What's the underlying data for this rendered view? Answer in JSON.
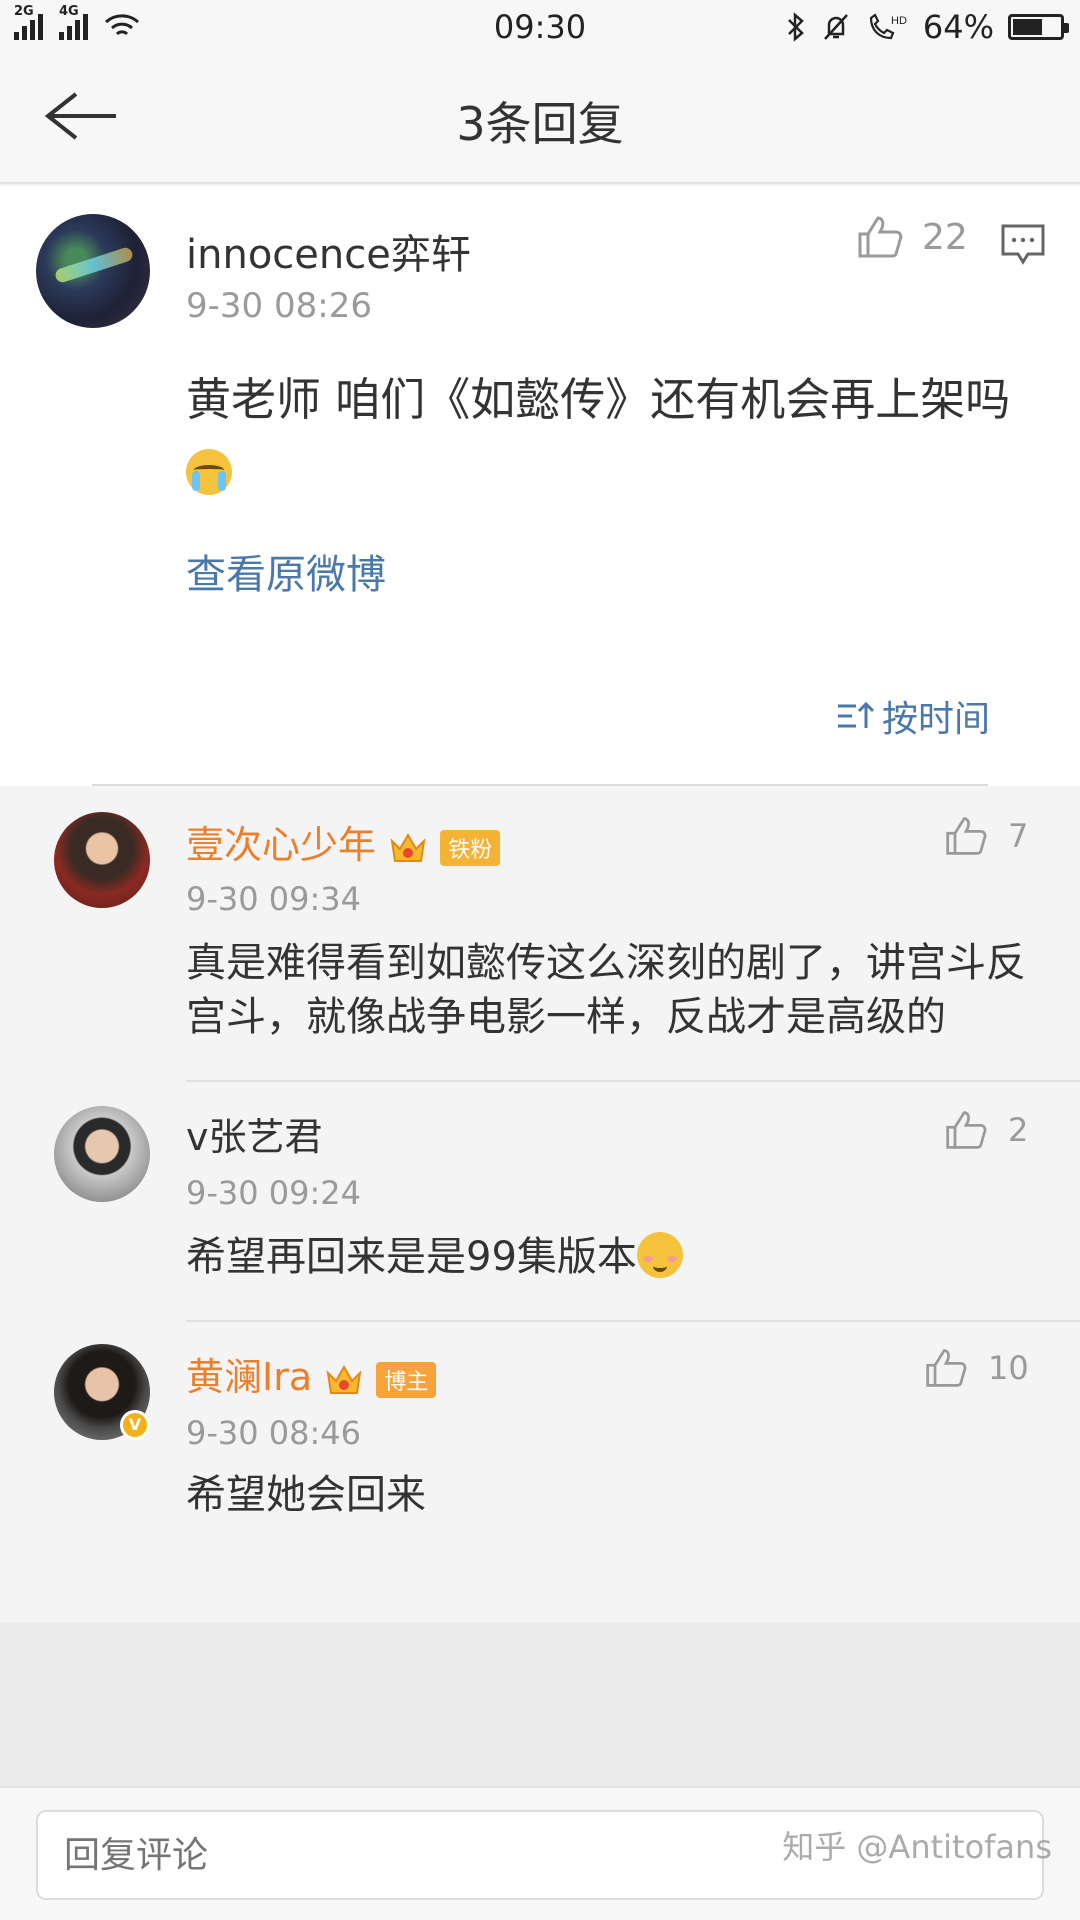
{
  "status_bar": {
    "signal1_label": "2G",
    "signal2_label": "4G",
    "time": "09:30",
    "battery": "64%",
    "battery_level": 0.64
  },
  "header": {
    "title": "3条回复"
  },
  "main_comment": {
    "username": "innocence弈轩",
    "time": "9-30 08:26",
    "likes": "22",
    "text": "黄老师 咱们《如懿传》还有机会再上架吗",
    "view_original": "查看原微博",
    "sort_label": "按时间"
  },
  "replies": [
    {
      "username": "壹次心少年",
      "badge": "铁粉",
      "time": "9-30 09:34",
      "likes": "7",
      "text": "真是难得看到如懿传这么深刻的剧了，讲宫斗反宫斗，就像战争电影一样，反战才是高级的"
    },
    {
      "username": "v张艺君",
      "time": "9-30 09:24",
      "likes": "2",
      "text": "希望再回来是是99集版本"
    },
    {
      "username": "黄澜Ira",
      "badge": "博主",
      "time": "9-30 08:46",
      "likes": "10",
      "text": "希望她会回来"
    }
  ],
  "bottom_bar": {
    "input_placeholder": "回复评论",
    "watermark": "知乎 @Antitofans"
  },
  "colors": {
    "link_blue": "#4a78aa",
    "vip_orange": "#eb7f2a",
    "text_gray": "#9a9a9a"
  }
}
